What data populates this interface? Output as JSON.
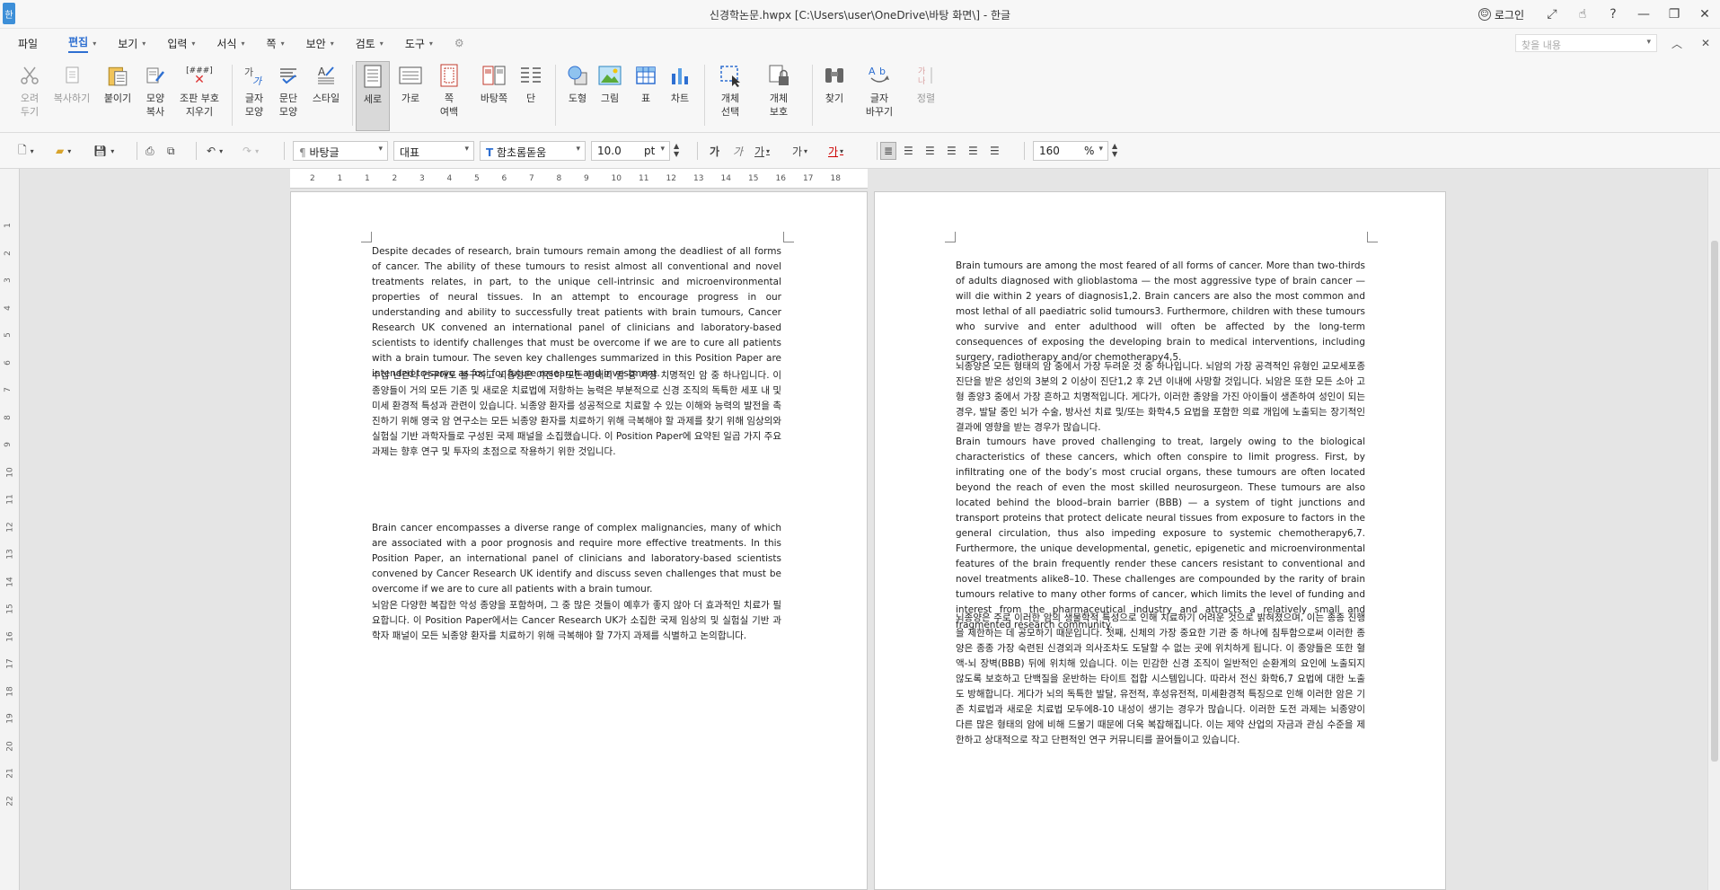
{
  "window": {
    "title": "신경학논문.hwpx [C:\\Users\\user\\OneDrive\\바탕 화면\\] - 한글",
    "login": "로그인",
    "app_icon": "한"
  },
  "menu": {
    "items": [
      "파일",
      "편집",
      "보기",
      "입력",
      "서식",
      "쪽",
      "보안",
      "검토",
      "도구"
    ],
    "active": "편집",
    "search_placeholder": "찾을 내용"
  },
  "ribbon": {
    "buttons": [
      {
        "l1": "오려",
        "l2": "두기"
      },
      {
        "l1": "복사하기",
        "l2": ""
      },
      {
        "l1": "붙이기",
        "l2": ""
      },
      {
        "l1": "모양",
        "l2": "복사"
      },
      {
        "l1": "조판 부호",
        "l2": "지우기"
      },
      {
        "l1": "글자",
        "l2": "모양"
      },
      {
        "l1": "문단",
        "l2": "모양"
      },
      {
        "l1": "스타일",
        "l2": ""
      },
      {
        "l1": "세로",
        "l2": ""
      },
      {
        "l1": "가로",
        "l2": ""
      },
      {
        "l1": "쪽",
        "l2": "여백"
      },
      {
        "l1": "바탕쪽",
        "l2": ""
      },
      {
        "l1": "단",
        "l2": ""
      },
      {
        "l1": "도형",
        "l2": ""
      },
      {
        "l1": "그림",
        "l2": ""
      },
      {
        "l1": "표",
        "l2": ""
      },
      {
        "l1": "차트",
        "l2": ""
      },
      {
        "l1": "개체",
        "l2": "선택"
      },
      {
        "l1": "개체",
        "l2": "보호"
      },
      {
        "l1": "찾기",
        "l2": ""
      },
      {
        "l1": "글자",
        "l2": "바꾸기"
      },
      {
        "l1": "정렬",
        "l2": ""
      }
    ],
    "code_icon_text": "[###]"
  },
  "format_bar": {
    "style": "바탕글",
    "lang": "대표",
    "font": "함초롬돋움",
    "font_icon": "T",
    "size": "10.0",
    "unit": "pt",
    "zoom": "160",
    "zoom_unit": "%",
    "char_buttons": [
      "가",
      "가",
      "가",
      "가",
      "가"
    ]
  },
  "rulers": {
    "h_ticks": [
      "2",
      "1",
      "1",
      "2",
      "3",
      "4",
      "5",
      "6",
      "7",
      "8",
      "9",
      "10",
      "11",
      "12",
      "13",
      "14",
      "15",
      "16",
      "17",
      "18"
    ],
    "v_ticks": [
      "1",
      "2",
      "3",
      "4",
      "5",
      "6",
      "7",
      "8",
      "9",
      "10",
      "11",
      "12",
      "13",
      "14",
      "15",
      "16",
      "17",
      "18",
      "19",
      "20",
      "21",
      "22"
    ]
  },
  "page1": {
    "paragraphs": [
      "Despite decades of research, brain tumours remain among the deadliest of all forms of cancer. The ability of these tumours to resist almost all conventional and novel treatments relates, in part, to the unique cell-intrinsic and microenvironmental properties of neural tissues. In an attempt to encourage progress in our understanding and ability to successfully treat patients with brain tumours, Cancer Research UK convened an international panel of clinicians and laboratory-based scientists to identify challenges that must be overcome if we are to cure all patients with a brain tumour. The seven key challenges summarized in this Position Paper are intended to serve as foci for future research and investment.",
      "수십 년간의 연구에도 불구하고 뇌종양은 여전히 모든 형태의 암 중 가장 치명적인 암 중 하나입니다. 이 종양들이 거의 모든 기존 및 새로운 치료법에 저항하는 능력은 부분적으로 신경 조직의 독특한 세포 내 및 미세 환경적 특성과 관련이 있습니다. 뇌종양 환자를 성공적으로 치료할 수 있는 이해와 능력의 발전을 촉진하기 위해 영국 암 연구소는 모든 뇌종양 환자를 치료하기 위해 극복해야 할 과제를 찾기 위해 임상의와 실험실 기반 과학자들로 구성된 국제 패널을 소집했습니다. 이 Position Paper에 요약된 일곱 가지 주요 과제는 향후 연구 및 투자의 초점으로 작용하기 위한 것입니다.",
      "Brain cancer encompasses a diverse range of complex malignancies, many of which are associated with a poor prognosis and require more effective treatments. In this Position Paper, an international panel of clinicians and laboratory-based scientists convened by Cancer Research UK identify and discuss seven challenges that must be overcome if we are to cure all patients with a brain tumour.",
      "뇌암은 다양한 복잡한 악성 종양을 포함하며, 그 중 많은 것들이 예후가 좋지 않아 더 효과적인 치료가 필요합니다. 이 Position Paper에서는 Cancer Research UK가 소집한 국제 임상의 및 실험실 기반 과학자 패널이 모든 뇌종양 환자를 치료하기 위해 극복해야 할 7가지 과제를 식별하고 논의합니다."
    ]
  },
  "page2": {
    "paragraphs": [
      "Brain tumours are among the most feared of all forms of cancer. More than two-thirds of adults diagnosed with glioblastoma — the most aggressive type of brain cancer — will die within 2 years of diagnosis1,2. Brain cancers are also the most common and most lethal of all paediatric solid tumours3. Furthermore, children with these tumours who survive and enter adulthood will often be affected by the long-term consequences of exposing the developing brain to medical interventions, including surgery, radiotherapy and/or chemotherapy4,5.",
      "뇌종양은 모든 형태의 암 중에서 가장 두려운 것 중 하나입니다. 뇌암의 가장 공격적인 유형인 교모세포종 진단을 받은 성인의 3분의 2 이상이 진단1,2 후 2년 이내에 사망할 것입니다. 뇌암은 또한 모든 소아 고형 종양3 중에서 가장 흔하고 치명적입니다. 게다가, 이러한 종양을 가진 아이들이 생존하여 성인이 되는 경우, 발달 중인 뇌가 수술, 방사선 치료 및/또는 화학4,5 요법을 포함한 의료 개입에 노출되는 장기적인 결과에 영향을 받는 경우가 많습니다.",
      "Brain tumours have proved challenging to treat, largely owing to the biological characteristics of these cancers, which often conspire to limit progress. First, by infiltrating one of the body’s most crucial organs, these tumours are often located beyond the reach of even the most skilled neurosurgeon. These tumours are also located behind the blood–brain barrier (BBB) — a system of tight junctions and transport proteins that protect delicate neural tissues from exposure to factors in the general circulation, thus also impeding exposure to systemic chemotherapy6,7. Furthermore, the unique developmental, genetic, epigenetic and microenvironmental features of the brain frequently render these cancers resistant to conventional and novel treatments alike8–10. These challenges are compounded by the rarity of brain tumours relative to many other forms of cancer, which limits the level of funding and interest from the pharmaceutical industry and attracts a relatively small and fragmented research community.",
      "뇌종양은 주로 이러한 암의 생물학적 특성으로 인해 치료하기 어려운 것으로 밝혀졌으며, 이는 종종 진행을 제한하는 데 공모하기 때문입니다. 첫째, 신체의 가장 중요한 기관 중 하나에 침투함으로써 이러한 종양은 종종 가장 숙련된 신경외과 의사조차도 도달할 수 없는 곳에 위치하게 됩니다. 이 종양들은 또한 혈액-뇌 장벽(BBB) 뒤에 위치해 있습니다. 이는 민감한 신경 조직이 일반적인 순환계의 요인에 노출되지 않도록 보호하고 단백질을 운반하는 타이트 접합 시스템입니다. 따라서 전신 화학6,7 요법에 대한 노출도 방해합니다. 게다가 뇌의 독특한 발달, 유전적, 후성유전적, 미세환경적 특징으로 인해 이러한 암은 기존 치료법과 새로운 치료법 모두에8-10 내성이 생기는 경우가 많습니다. 이러한 도전 과제는 뇌종양이 다른 많은 형태의 암에 비해 드물기 때문에 더욱 복잡해집니다. 이는 제약 산업의 자금과 관심 수준을 제한하고 상대적으로 작고 단편적인 연구 커뮤니티를 끌어들이고 있습니다."
    ]
  }
}
